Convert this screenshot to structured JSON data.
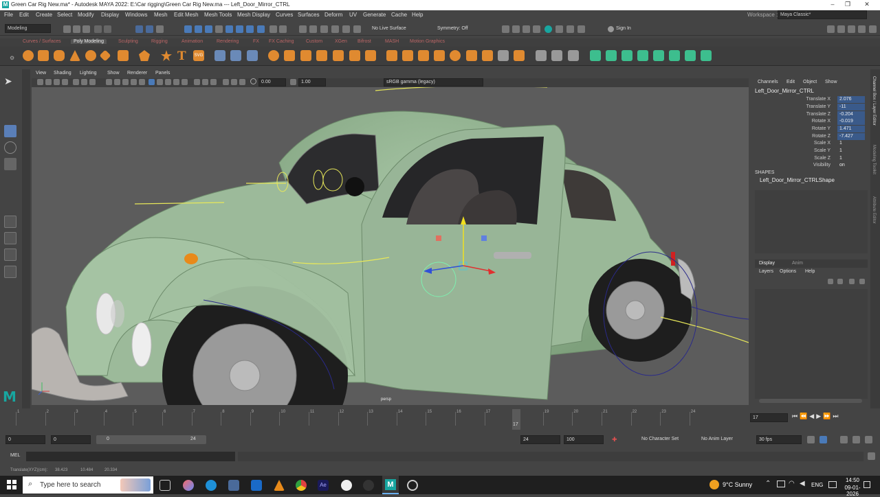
{
  "window": {
    "title": "Green Car Rig New.ma* - Autodesk MAYA 2022: E:\\Car rigging\\Green Car Rig New.ma  ---  Left_Door_Mirror_CTRL",
    "minimize": "–",
    "maximize": "❐",
    "close": "✕"
  },
  "menu": {
    "items": [
      "File",
      "Edit",
      "Create",
      "Select",
      "Modify",
      "Display",
      "Windows",
      "Mesh",
      "Edit Mesh",
      "Mesh Tools",
      "Mesh Display",
      "Curves",
      "Surfaces",
      "Deform",
      "UV",
      "Generate",
      "Cache",
      "Help"
    ],
    "workspace_label": "Workspace :",
    "workspace_value": "Maya Classic*"
  },
  "statusline": {
    "mode": "Modeling",
    "live_surface": "No Live Surface",
    "symmetry": "Symmetry: Off",
    "signin": "Sign In"
  },
  "shelf": {
    "tabs": [
      "Curves / Surfaces",
      "Poly Modeling",
      "Sculpting",
      "Rigging",
      "Animation",
      "Rendering",
      "FX",
      "FX Caching",
      "Custom",
      "XGen",
      "Bifrost",
      "MASH",
      "Motion Graphics"
    ],
    "active_tab": "Poly Modeling",
    "text_icon": "T",
    "svg_icon": "SVG"
  },
  "viewport": {
    "menu": [
      "View",
      "Shading",
      "Lighting",
      "Show",
      "Renderer",
      "Panels"
    ],
    "exposure": "0.00",
    "gamma": "1.00",
    "color_space": "sRGB gamma (legacy)",
    "camera_label": "persp"
  },
  "channelbox": {
    "menu": [
      "Channels",
      "Edit",
      "Object",
      "Show"
    ],
    "object_name": "Left_Door_Mirror_CTRL",
    "channels": [
      {
        "label": "Translate X",
        "value": "2.076",
        "keyed": true
      },
      {
        "label": "Translate Y",
        "value": "-11",
        "keyed": true
      },
      {
        "label": "Translate Z",
        "value": "-0.204",
        "keyed": true
      },
      {
        "label": "Rotate X",
        "value": "-0.019",
        "keyed": true
      },
      {
        "label": "Rotate Y",
        "value": "1.471",
        "keyed": true
      },
      {
        "label": "Rotate Z",
        "value": "-7.427",
        "keyed": true
      },
      {
        "label": "Scale X",
        "value": "1",
        "keyed": false
      },
      {
        "label": "Scale Y",
        "value": "1",
        "keyed": false
      },
      {
        "label": "Scale Z",
        "value": "1",
        "keyed": false
      },
      {
        "label": "Visibility",
        "value": "on",
        "keyed": false
      }
    ],
    "shapes_header": "SHAPES",
    "shape_name": "Left_Door_Mirror_CTRLShape"
  },
  "layer_editor": {
    "tabs": [
      "Display",
      "Anim"
    ],
    "active_tab": "Display",
    "menu": [
      "Layers",
      "Options",
      "Help"
    ]
  },
  "side_tabs": [
    "Channel Box / Layer Editor",
    "Modeling Toolkit",
    "Attribute Editor"
  ],
  "timeline": {
    "ticks": [
      "1",
      "2",
      "3",
      "4",
      "5",
      "6",
      "7",
      "8",
      "9",
      "10",
      "11",
      "12",
      "13",
      "14",
      "15",
      "16",
      "17",
      "18",
      "19",
      "20",
      "21",
      "22",
      "23",
      "24"
    ],
    "current_frame": "17",
    "current_frame_field": "17"
  },
  "range": {
    "start": "0",
    "playback_start": "0",
    "slider_start": "0",
    "slider_end": "24",
    "playback_end": "24",
    "end": "100",
    "character_set": "No Character Set",
    "anim_layer": "No Anim Layer",
    "fps": "30 fps"
  },
  "cmdline": {
    "label": "MEL"
  },
  "helpline": {
    "text": "Translate(XYZ)(cm):",
    "x": "38.423",
    "y": "10.484",
    "z": "20.334"
  },
  "taskbar": {
    "search_placeholder": "Type here to search",
    "weather": "9°C  Sunny",
    "language": "ENG",
    "time": "14:50",
    "date": "09-01-2026"
  },
  "colors": {
    "car_body": "#9cba9a",
    "viewport_bg": "#5c5c5c",
    "accent_blue": "#3a5a8a",
    "maya_teal": "#18a6a0"
  }
}
